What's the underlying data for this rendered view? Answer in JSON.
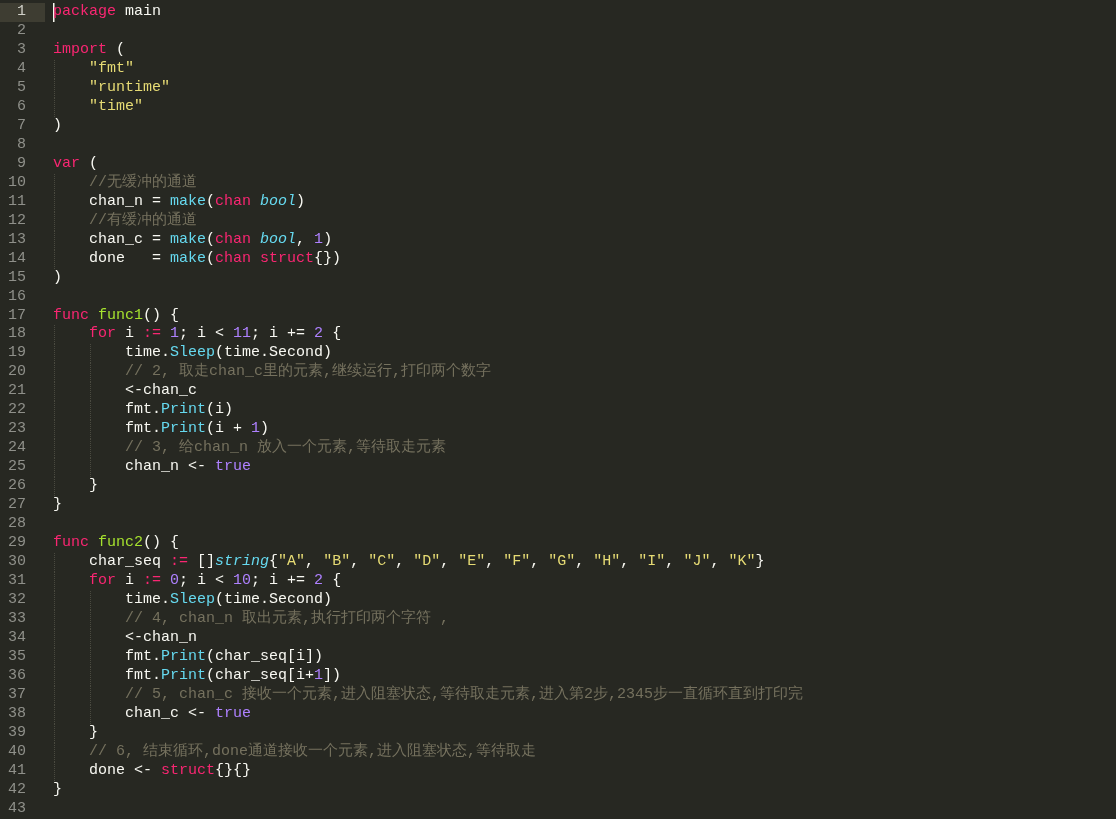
{
  "lines": [
    {
      "number": "1",
      "selected": true,
      "tokens": [
        {
          "kind": "keyword",
          "text": "package"
        },
        {
          "kind": "plain",
          "text": " main"
        }
      ]
    },
    {
      "number": "2",
      "selected": false
    },
    {
      "number": "3",
      "selected": false,
      "tokens": [
        {
          "kind": "keyword",
          "text": "import"
        },
        {
          "kind": "plain",
          "text": " ("
        }
      ]
    },
    {
      "number": "4",
      "selected": false,
      "tokens": [
        {
          "kind": "string",
          "text": "    \"fmt\""
        }
      ]
    },
    {
      "number": "5",
      "selected": false,
      "tokens": [
        {
          "kind": "string",
          "text": "    \"runtime\""
        }
      ]
    },
    {
      "number": "6",
      "selected": false,
      "tokens": [
        {
          "kind": "string",
          "text": "    \"time\""
        }
      ]
    },
    {
      "number": "7",
      "selected": false,
      "tokens": [
        {
          "kind": "plain",
          "text": ")"
        }
      ]
    },
    {
      "number": "8",
      "selected": false
    },
    {
      "number": "9",
      "selected": false,
      "tokens": [
        {
          "kind": "keyword",
          "text": "var"
        },
        {
          "kind": "plain",
          "text": " ("
        }
      ]
    },
    {
      "number": "10",
      "selected": false,
      "tokens": [
        {
          "kind": "comment",
          "text": "    //无缓冲的通道"
        }
      ]
    },
    {
      "number": "11",
      "selected": false,
      "tokens": [
        {
          "kind": "plain",
          "text": "    chan_n = "
        },
        {
          "kind": "builtin",
          "text": "make"
        },
        {
          "kind": "plain",
          "text": "("
        },
        {
          "kind": "keyword",
          "text": "chan"
        },
        {
          "kind": "type",
          "text": " bool"
        },
        {
          "kind": "plain",
          "text": ")"
        }
      ]
    },
    {
      "number": "12",
      "selected": false,
      "tokens": [
        {
          "kind": "comment",
          "text": "    //有缓冲的通道"
        }
      ]
    },
    {
      "number": "13",
      "selected": false,
      "tokens": [
        {
          "kind": "plain",
          "text": "    chan_c = "
        },
        {
          "kind": "builtin",
          "text": "make"
        },
        {
          "kind": "plain",
          "text": "("
        },
        {
          "kind": "keyword",
          "text": "chan"
        },
        {
          "kind": "type",
          "text": " bool"
        },
        {
          "kind": "plain",
          "text": ", "
        },
        {
          "kind": "number",
          "text": "1"
        },
        {
          "kind": "plain",
          "text": ")"
        }
      ]
    },
    {
      "number": "14",
      "selected": false,
      "tokens": [
        {
          "kind": "plain",
          "text": "    done   = "
        },
        {
          "kind": "builtin",
          "text": "make"
        },
        {
          "kind": "plain",
          "text": "("
        },
        {
          "kind": "keyword",
          "text": "chan struct"
        },
        {
          "kind": "plain",
          "text": "{})"
        }
      ]
    },
    {
      "number": "15",
      "selected": false,
      "tokens": [
        {
          "kind": "plain",
          "text": ")"
        }
      ]
    },
    {
      "number": "16",
      "selected": false
    },
    {
      "number": "17",
      "selected": false,
      "tokens": [
        {
          "kind": "keyword",
          "text": "func"
        },
        {
          "kind": "function",
          "text": " func1"
        },
        {
          "kind": "plain",
          "text": "() {"
        }
      ]
    },
    {
      "number": "18",
      "selected": false,
      "tokens": [
        {
          "kind": "keyword",
          "text": "    for"
        },
        {
          "kind": "plain",
          "text": " i "
        },
        {
          "kind": "keyword",
          "text": ":="
        },
        {
          "kind": "number",
          "text": " 1"
        },
        {
          "kind": "plain",
          "text": "; i < "
        },
        {
          "kind": "number",
          "text": "11"
        },
        {
          "kind": "plain",
          "text": "; i += "
        },
        {
          "kind": "number",
          "text": "2"
        },
        {
          "kind": "plain",
          "text": " {"
        }
      ]
    },
    {
      "number": "19",
      "selected": false,
      "tokens": [
        {
          "kind": "plain",
          "text": "        time."
        },
        {
          "kind": "builtin",
          "text": "Sleep"
        },
        {
          "kind": "plain",
          "text": "(time.Second)"
        }
      ]
    },
    {
      "number": "20",
      "selected": false,
      "tokens": [
        {
          "kind": "comment",
          "text": "        // 2, 取走chan_c里的元素,继续运行,打印两个数字"
        }
      ]
    },
    {
      "number": "21",
      "selected": false,
      "tokens": [
        {
          "kind": "plain",
          "text": "        <-chan_c"
        }
      ]
    },
    {
      "number": "22",
      "selected": false,
      "tokens": [
        {
          "kind": "plain",
          "text": "        fmt."
        },
        {
          "kind": "builtin",
          "text": "Print"
        },
        {
          "kind": "plain",
          "text": "(i)"
        }
      ]
    },
    {
      "number": "23",
      "selected": false,
      "tokens": [
        {
          "kind": "plain",
          "text": "        fmt."
        },
        {
          "kind": "builtin",
          "text": "Print"
        },
        {
          "kind": "plain",
          "text": "(i + "
        },
        {
          "kind": "number",
          "text": "1"
        },
        {
          "kind": "plain",
          "text": ")"
        }
      ]
    },
    {
      "number": "24",
      "selected": false,
      "tokens": [
        {
          "kind": "comment",
          "text": "        // 3, 给chan_n 放入一个元素,等待取走元素"
        }
      ]
    },
    {
      "number": "25",
      "selected": false,
      "tokens": [
        {
          "kind": "plain",
          "text": "        chan_n <- "
        },
        {
          "kind": "number",
          "text": "true"
        }
      ]
    },
    {
      "number": "26",
      "selected": false,
      "tokens": [
        {
          "kind": "plain",
          "text": "    }"
        }
      ]
    },
    {
      "number": "27",
      "selected": false,
      "tokens": [
        {
          "kind": "plain",
          "text": "}"
        }
      ]
    },
    {
      "number": "28",
      "selected": false
    },
    {
      "number": "29",
      "selected": false,
      "tokens": [
        {
          "kind": "keyword",
          "text": "func"
        },
        {
          "kind": "function",
          "text": " func2"
        },
        {
          "kind": "plain",
          "text": "() {"
        }
      ]
    },
    {
      "number": "30",
      "selected": false,
      "tokens": [
        {
          "kind": "plain",
          "text": "    char_seq "
        },
        {
          "kind": "keyword",
          "text": ":="
        },
        {
          "kind": "plain",
          "text": " []"
        },
        {
          "kind": "type",
          "text": "string"
        },
        {
          "kind": "plain",
          "text": "{"
        },
        {
          "kind": "string",
          "text": "\"A\""
        },
        {
          "kind": "plain",
          "text": ", "
        },
        {
          "kind": "string",
          "text": "\"B\""
        },
        {
          "kind": "plain",
          "text": ", "
        },
        {
          "kind": "string",
          "text": "\"C\""
        },
        {
          "kind": "plain",
          "text": ", "
        },
        {
          "kind": "string",
          "text": "\"D\""
        },
        {
          "kind": "plain",
          "text": ", "
        },
        {
          "kind": "string",
          "text": "\"E\""
        },
        {
          "kind": "plain",
          "text": ", "
        },
        {
          "kind": "string",
          "text": "\"F\""
        },
        {
          "kind": "plain",
          "text": ", "
        },
        {
          "kind": "string",
          "text": "\"G\""
        },
        {
          "kind": "plain",
          "text": ", "
        },
        {
          "kind": "string",
          "text": "\"H\""
        },
        {
          "kind": "plain",
          "text": ", "
        },
        {
          "kind": "string",
          "text": "\"I\""
        },
        {
          "kind": "plain",
          "text": ", "
        },
        {
          "kind": "string",
          "text": "\"J\""
        },
        {
          "kind": "plain",
          "text": ", "
        },
        {
          "kind": "string",
          "text": "\"K\""
        },
        {
          "kind": "plain",
          "text": "}"
        }
      ]
    },
    {
      "number": "31",
      "selected": false,
      "tokens": [
        {
          "kind": "keyword",
          "text": "    for"
        },
        {
          "kind": "plain",
          "text": " i "
        },
        {
          "kind": "keyword",
          "text": ":="
        },
        {
          "kind": "number",
          "text": " 0"
        },
        {
          "kind": "plain",
          "text": "; i < "
        },
        {
          "kind": "number",
          "text": "10"
        },
        {
          "kind": "plain",
          "text": "; i += "
        },
        {
          "kind": "number",
          "text": "2"
        },
        {
          "kind": "plain",
          "text": " {"
        }
      ]
    },
    {
      "number": "32",
      "selected": false,
      "tokens": [
        {
          "kind": "plain",
          "text": "        time."
        },
        {
          "kind": "builtin",
          "text": "Sleep"
        },
        {
          "kind": "plain",
          "text": "(time.Second)"
        }
      ]
    },
    {
      "number": "33",
      "selected": false,
      "tokens": [
        {
          "kind": "comment",
          "text": "        // 4, chan_n 取出元素,执行打印两个字符 ,"
        }
      ]
    },
    {
      "number": "34",
      "selected": false,
      "tokens": [
        {
          "kind": "plain",
          "text": "        <-chan_n"
        }
      ]
    },
    {
      "number": "35",
      "selected": false,
      "tokens": [
        {
          "kind": "plain",
          "text": "        fmt."
        },
        {
          "kind": "builtin",
          "text": "Print"
        },
        {
          "kind": "plain",
          "text": "(char_seq[i])"
        }
      ]
    },
    {
      "number": "36",
      "selected": false,
      "tokens": [
        {
          "kind": "plain",
          "text": "        fmt."
        },
        {
          "kind": "builtin",
          "text": "Print"
        },
        {
          "kind": "plain",
          "text": "(char_seq[i+"
        },
        {
          "kind": "number",
          "text": "1"
        },
        {
          "kind": "plain",
          "text": "])"
        }
      ]
    },
    {
      "number": "37",
      "selected": false,
      "tokens": [
        {
          "kind": "comment",
          "text": "        // 5, chan_c 接收一个元素,进入阻塞状态,等待取走元素,进入第2步,2345步一直循环直到打印完"
        }
      ]
    },
    {
      "number": "38",
      "selected": false,
      "tokens": [
        {
          "kind": "plain",
          "text": "        chan_c <- "
        },
        {
          "kind": "number",
          "text": "true"
        }
      ]
    },
    {
      "number": "39",
      "selected": false,
      "tokens": [
        {
          "kind": "plain",
          "text": "    }"
        }
      ]
    },
    {
      "number": "40",
      "selected": false,
      "tokens": [
        {
          "kind": "comment",
          "text": "    // 6, 结束循环,done通道接收一个元素,进入阻塞状态,等待取走"
        }
      ]
    },
    {
      "number": "41",
      "selected": false,
      "tokens": [
        {
          "kind": "plain",
          "text": "    done <- "
        },
        {
          "kind": "keyword",
          "text": "struct"
        },
        {
          "kind": "plain",
          "text": "{}{}"
        }
      ]
    },
    {
      "number": "42",
      "selected": false,
      "tokens": [
        {
          "kind": "plain",
          "text": "}"
        }
      ]
    },
    {
      "number": "43",
      "selected": false
    }
  ]
}
